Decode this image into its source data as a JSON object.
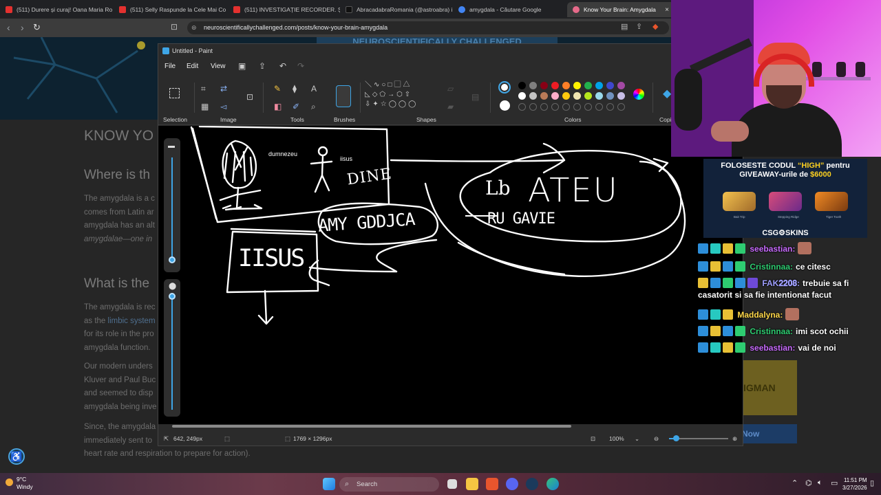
{
  "browser": {
    "tabs": [
      {
        "label": "(511) Durere și curaj! Oana Maria Ro",
        "fav": "#e4312f"
      },
      {
        "label": "(511) Selly Raspunde la Cele Mai Co",
        "fav": "#e4312f"
      },
      {
        "label": "(511) INVESTIGAȚIE RECORDER. Și im",
        "fav": "#e4312f"
      },
      {
        "label": "AbracadabraRomania (@astroabra) i",
        "fav": "#111111"
      },
      {
        "label": "amygdala - Căutare Google",
        "fav": "#4285f4"
      },
      {
        "label": "Know Your Brain: Amygdala",
        "fav": "#e66a8a"
      }
    ],
    "url": "neuroscientificallychallenged.com/posts/know-your-brain-amygdala"
  },
  "webpage": {
    "site_name": "NEUROSCIENTIFICALLY CHALLENGED",
    "title": "KNOW YO",
    "h2_where": "Where is th",
    "p1": [
      "The amygdala is a c",
      "comes from Latin ar",
      "amygdala has an alt",
      "amygdalae—one in"
    ],
    "h2_what": "What is the",
    "p2_a": "The amygdala is rec",
    "p2_b_pre": "as the ",
    "p2_b_link": "limbic system",
    "p2_c": "for its role in the pro",
    "p2_d": "amygdala function.",
    "p3": [
      "Our modern unders",
      "Kluver and Paul Buc",
      "and seemed to disp",
      "amygdala being inve"
    ],
    "p4_a": "Since, the amygdala",
    "p4_b": "immediately sent to",
    "p4_c": "heart rate and respiration to prepare for action).",
    "ad_text": "IGMAN",
    "ad_button": "Now"
  },
  "paint": {
    "window_title": "Untitled - Paint",
    "menu": {
      "file": "File",
      "edit": "Edit",
      "view": "View"
    },
    "groups": {
      "selection": "Selection",
      "image": "Image",
      "tools": "Tools",
      "brushes": "Brushes",
      "shapes": "Shapes",
      "colors": "Colors",
      "copilot": "Copi"
    },
    "palette_row1": [
      "#000000",
      "#7f7f7f",
      "#880015",
      "#ed1c24",
      "#ff7f27",
      "#fff200",
      "#22b14c",
      "#00a2e8",
      "#3f48cc",
      "#a349a4"
    ],
    "palette_row2": [
      "#ffffff",
      "#c3c3c3",
      "#b97a57",
      "#ffaec9",
      "#ffc90e",
      "#efe4b0",
      "#b5e61d",
      "#99d9ea",
      "#7092be",
      "#c8bfe7"
    ],
    "drawing_text": {
      "dumnezeu": "dumnezeu",
      "iisus_small": "iisus",
      "dine": "DINE",
      "amygdala": "AMY GDDJCA",
      "iisus_big": "IISUS",
      "lb": "Lb",
      "ateu": "ATEU",
      "ru_gavie": "RU GAVIE"
    },
    "status": {
      "cursor_pos": "642, 249px",
      "canvas_size": "1769 × 1296px",
      "zoom": "100%"
    }
  },
  "stream": {
    "banner": {
      "line1_pre": "FOLOSESTE CODUL ",
      "line1_code": "“HIGH”",
      "line1_post": " pentru",
      "line2_pre": "GIVEAWAY-urile de ",
      "line2_amount": "$6000",
      "items": [
        "Bait Trip",
        "Stepping Ridge",
        "Tiger Tooth"
      ],
      "logo": "CSG⚙SKINS"
    },
    "chat": [
      {
        "user": "seebastian:",
        "color": "#c86bff",
        "text": "",
        "emote": true
      },
      {
        "user": "Cristinnaa:",
        "color": "#2ecc71",
        "text": "ce citesc",
        "emote": false
      },
      {
        "user": "FAK𝟐𝟐𝟎𝟖:",
        "color": "#a0a0ff",
        "text": "trebuie sa fi casatorit si sa fie intentionat facut",
        "emote": false
      },
      {
        "user": "Maddalyna:",
        "color": "#ffd84a",
        "text": "",
        "emote": true
      },
      {
        "user": "Cristinnaa:",
        "color": "#2ecc71",
        "text": "imi scot ochii",
        "emote": false
      },
      {
        "user": "seebastian:",
        "color": "#c86bff",
        "text": "vai de noi",
        "emote": false
      }
    ]
  },
  "taskbar": {
    "temp": "9°C",
    "weather": "Windy",
    "search": "Search",
    "time": "11:51 PM",
    "date": "3/27/2026"
  }
}
